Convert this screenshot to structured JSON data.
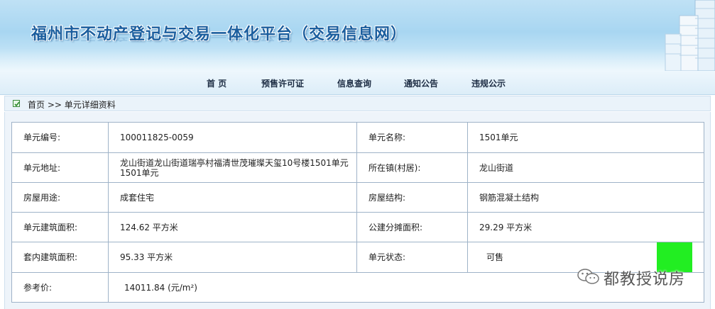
{
  "banner": {
    "title": "福州市不动产登记与交易一体化平台（交易信息网）"
  },
  "nav": {
    "items": [
      {
        "label": "首  页"
      },
      {
        "label": "预售许可证"
      },
      {
        "label": "信息查询"
      },
      {
        "label": "通知公告"
      },
      {
        "label": "违规公示"
      }
    ]
  },
  "breadcrumb": {
    "text": "首页 >> 单元详细资料"
  },
  "unit": {
    "rows": [
      {
        "l1": "单元编号:",
        "v1": "100011825-0059",
        "l2": "单元名称:",
        "v2": "1501单元"
      },
      {
        "l1": "单元地址:",
        "v1": "龙山街道龙山街道瑞亭村福清世茂璀璨天玺10号楼1501单元1501单元",
        "l2": "所在镇(村居):",
        "v2": "龙山街道"
      },
      {
        "l1": "房屋用途:",
        "v1": "成套住宅",
        "l2": "房屋结构:",
        "v2": "钢筋混凝土结构"
      },
      {
        "l1": "单元建筑面积:",
        "v1": "124.62 平方米",
        "l2": "公建分摊面积:",
        "v2": "29.29 平方米"
      },
      {
        "l1": "套内建筑面积:",
        "v1": "95.33 平方米",
        "l2": "单元状态:",
        "v2": "可售"
      },
      {
        "l1": "参考价:",
        "v1": "14011.84 (元/m²)"
      }
    ],
    "status_color": "#22ee22"
  },
  "watermark": {
    "text": "都教授说房"
  }
}
